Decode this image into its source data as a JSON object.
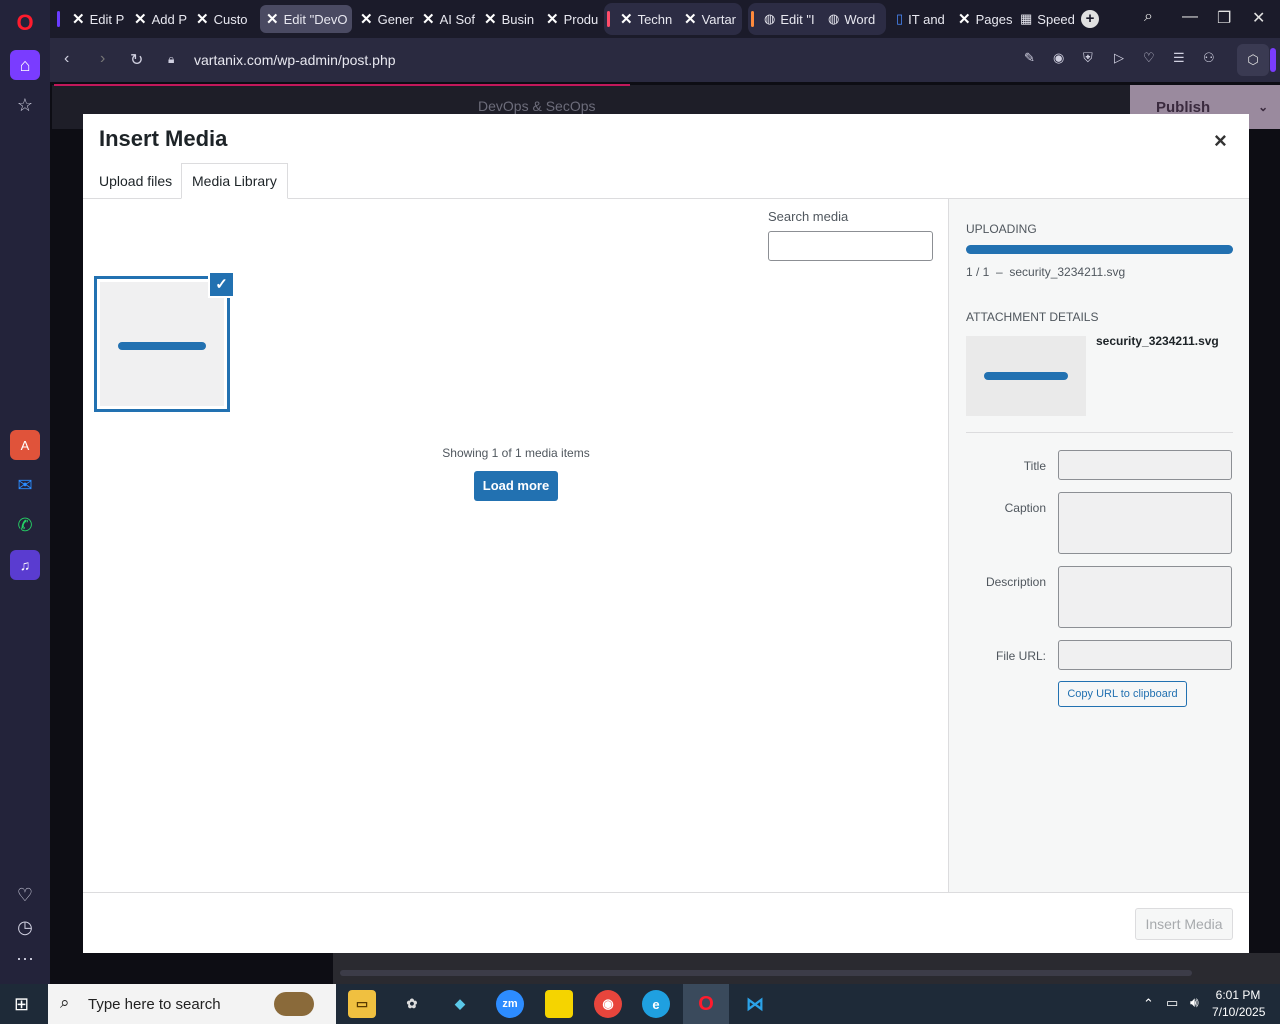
{
  "browser": {
    "tabs": [
      {
        "label": "Edit P",
        "active": false
      },
      {
        "label": "Add P",
        "active": false
      },
      {
        "label": "Custo",
        "active": false
      },
      {
        "label": "Edit \"DevO",
        "active": true
      },
      {
        "label": "Gener",
        "active": false
      },
      {
        "label": "AI Sof",
        "active": false
      },
      {
        "label": "Busin",
        "active": false
      },
      {
        "label": "Produ",
        "active": false
      },
      {
        "label": "Techn",
        "active": false
      },
      {
        "label": "Vartar",
        "active": false
      },
      {
        "label": "Edit \"I",
        "active": false
      },
      {
        "label": "Word",
        "active": false
      },
      {
        "label": "IT and",
        "active": false
      },
      {
        "label": "Pages",
        "active": false
      },
      {
        "label": "Speed",
        "active": false
      }
    ],
    "url": "vartanix.com/wp-admin/post.php"
  },
  "editor": {
    "context_label": "DevOps & SecOps",
    "publish_label": "Publish"
  },
  "modal": {
    "title": "Insert Media",
    "tabs": {
      "upload": "Upload files",
      "library": "Media Library"
    },
    "search_label": "Search media",
    "search_value": "",
    "showing_text": "Showing 1 of 1 media items",
    "load_more": "Load more",
    "insert_button": "Insert Media",
    "uploading": {
      "heading": "UPLOADING",
      "progress": 1.0,
      "status": "1 / 1  –  security_3234211.svg"
    },
    "details": {
      "heading": "ATTACHMENT DETAILS",
      "filename": "security_3234211.svg",
      "title_label": "Title",
      "caption_label": "Caption",
      "description_label": "Description",
      "url_label": "File URL:",
      "copy_url": "Copy URL to clipboard"
    }
  },
  "taskbar": {
    "search_placeholder": "Type here to search",
    "time": "6:01 PM",
    "date": "7/10/2025"
  },
  "colors": {
    "wp_blue": "#2271b1",
    "opera_red": "#ff1b2d"
  }
}
